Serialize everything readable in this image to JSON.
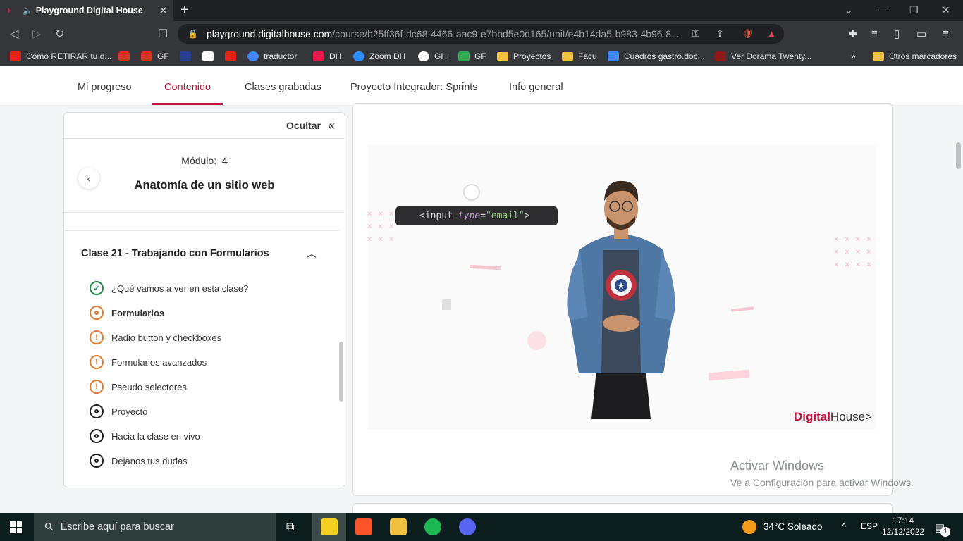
{
  "browser": {
    "tab_title": "Playground Digital House",
    "url_host": "playground.digitalhouse.com",
    "url_path": "/course/b25ff36f-dc68-4466-aac9-e7bbd5e0d165/unit/e4b14da5-b983-4b96-8...",
    "bookmarks": [
      {
        "label": "Cómo RETIRAR tu d...",
        "color": "#e62117"
      },
      {
        "label": "",
        "color": "#d93025"
      },
      {
        "label": "GF",
        "color": "#d93025"
      },
      {
        "label": "",
        "color": "#2a3f8f"
      },
      {
        "label": "",
        "color": "#ffffff"
      },
      {
        "label": "",
        "color": "#e62117"
      },
      {
        "label": "traductor",
        "color": "#4285f4"
      },
      {
        "label": "DH",
        "color": "#e8194a"
      },
      {
        "label": "Zoom DH",
        "color": "#2d8cff"
      },
      {
        "label": "GH",
        "color": "#ffffff"
      },
      {
        "label": "GF",
        "color": "#34a853"
      },
      {
        "label": "Proyectos",
        "folder": true
      },
      {
        "label": "Facu",
        "folder": true
      },
      {
        "label": "Cuadros gastro.doc...",
        "color": "#4285f4"
      },
      {
        "label": "Ver Dorama Twenty...",
        "color": "#8b1a1a"
      }
    ],
    "bookmarks_more": "»",
    "other_bookmarks": "Otros marcadores"
  },
  "nav": {
    "items": [
      {
        "label": "Mi progreso"
      },
      {
        "label": "Contenido",
        "active": true
      },
      {
        "label": "Clases grabadas"
      },
      {
        "label": "Proyecto Integrador: Sprints"
      },
      {
        "label": "Info general"
      }
    ]
  },
  "sidebar": {
    "hide_label": "Ocultar",
    "module_label": "Módulo:",
    "module_number": "4",
    "module_name": "Anatomía de un sitio web",
    "class_title": "Clase 21 - Trabajando con Formularios",
    "lessons": [
      {
        "label": "¿Qué vamos a ver en esta clase?",
        "status": "done"
      },
      {
        "label": "Formularios",
        "status": "current"
      },
      {
        "label": "Radio button y checkboxes",
        "status": "pending"
      },
      {
        "label": "Formularios avanzados",
        "status": "pending"
      },
      {
        "label": "Pseudo selectores",
        "status": "pending"
      },
      {
        "label": "Proyecto",
        "status": "todo"
      },
      {
        "label": "Hacia la clase en vivo",
        "status": "todo"
      },
      {
        "label": "Dejanos tus dudas",
        "status": "todo"
      }
    ]
  },
  "video": {
    "code_open": "<input ",
    "code_attr": "type",
    "code_eq": "=",
    "code_value": "\"email\"",
    "code_close": ">",
    "logo_a": "Digital",
    "logo_b": "House",
    "logo_arrow": ">"
  },
  "watermark": {
    "title": "Activar Windows",
    "subtitle": "Ve a Configuración para activar Windows."
  },
  "taskbar": {
    "search_placeholder": "Escribe aquí para buscar",
    "weather": "34°C  Soleado",
    "lang": "ESP",
    "time": "17:14",
    "date": "12/12/2022",
    "notifications": "1"
  }
}
